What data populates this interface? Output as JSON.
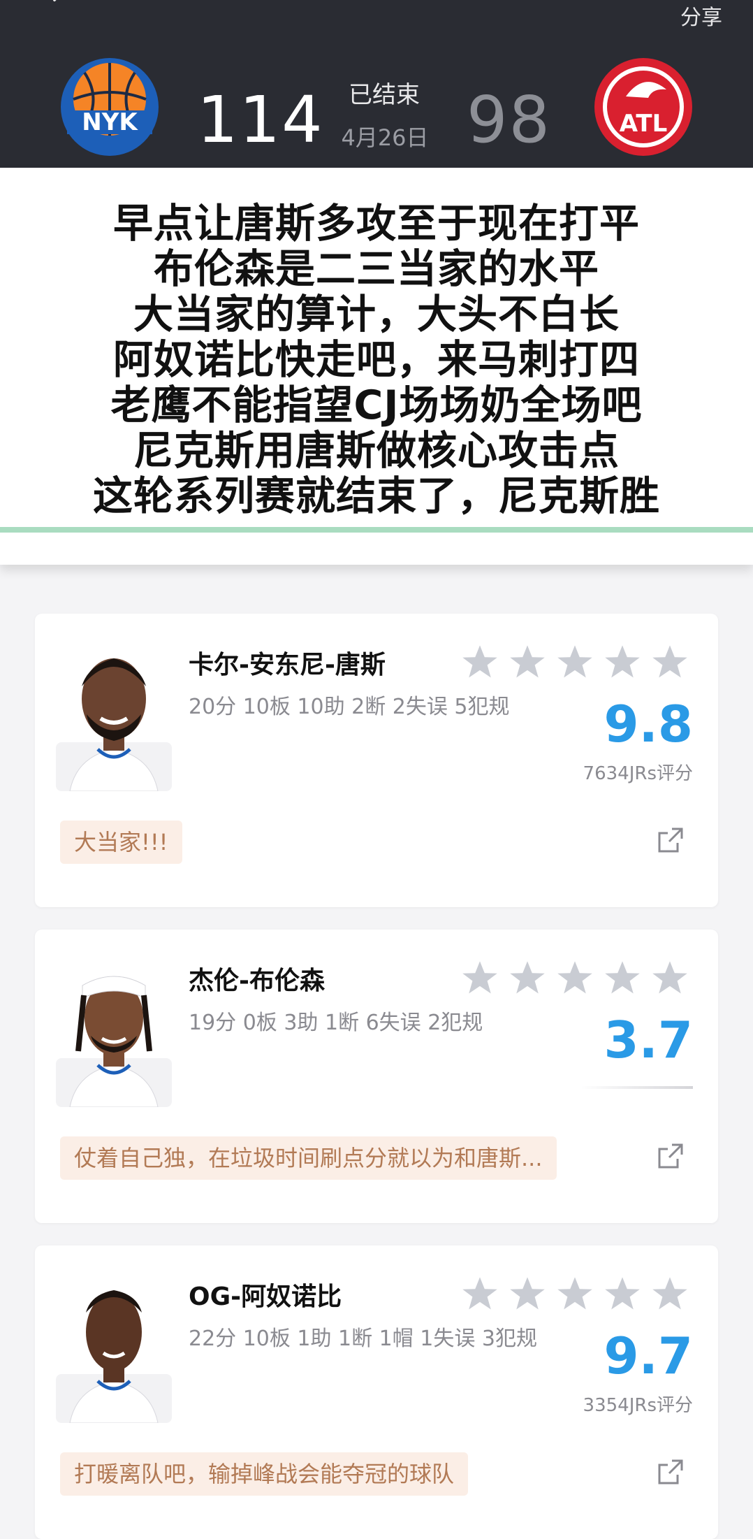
{
  "header": {
    "share_label": "分享",
    "home_team": {
      "abbr": "NYK",
      "score": "114"
    },
    "away_team": {
      "abbr": "ATL",
      "score": "98"
    },
    "status": "已结束",
    "date": "4月26日"
  },
  "overlay_comment": {
    "lines": [
      "早点让唐斯多攻至于现在打平",
      "布伦森是二三当家的水平",
      "大当家的算计，大头不白长",
      "阿奴诺比快走吧，来马刺打四",
      "老鹰不能指望CJ场场奶全场吧",
      "尼克斯用唐斯做核心攻击点",
      "这轮系列赛就结束了，尼克斯胜"
    ]
  },
  "players": [
    {
      "name": "卡尔-安东尼-唐斯",
      "stats": "20分 10板 10助 2断 2失误 5犯规",
      "rating": "9.8",
      "rating_count": "7634JRs评分",
      "stars_filled": 0,
      "comment": "大当家!!!"
    },
    {
      "name": "杰伦-布伦森",
      "stats": "19分 0板 3助 1断 6失误 2犯规",
      "rating": "3.7",
      "rating_count": "",
      "stars_filled": 0,
      "comment": "仗着自己独，在垃圾时间刷点分就以为和唐斯..."
    },
    {
      "name": "OG-阿奴诺比",
      "stats": "22分 10板 1助 1断 1帽 1失误 3犯规",
      "rating": "9.7",
      "rating_count": "3354JRs评分",
      "stars_filled": 0,
      "comment": "打暖离队吧，输掉峰战会能夺冠的球队"
    }
  ],
  "colors": {
    "header_bg": "#2a2c33",
    "rating_blue": "#2a9ae6",
    "comment_bg": "#fbeee6",
    "comment_text": "#b27a55",
    "knicks_blue": "#1d5fb8",
    "knicks_orange": "#f58426",
    "hawks_red": "#d9202f"
  }
}
